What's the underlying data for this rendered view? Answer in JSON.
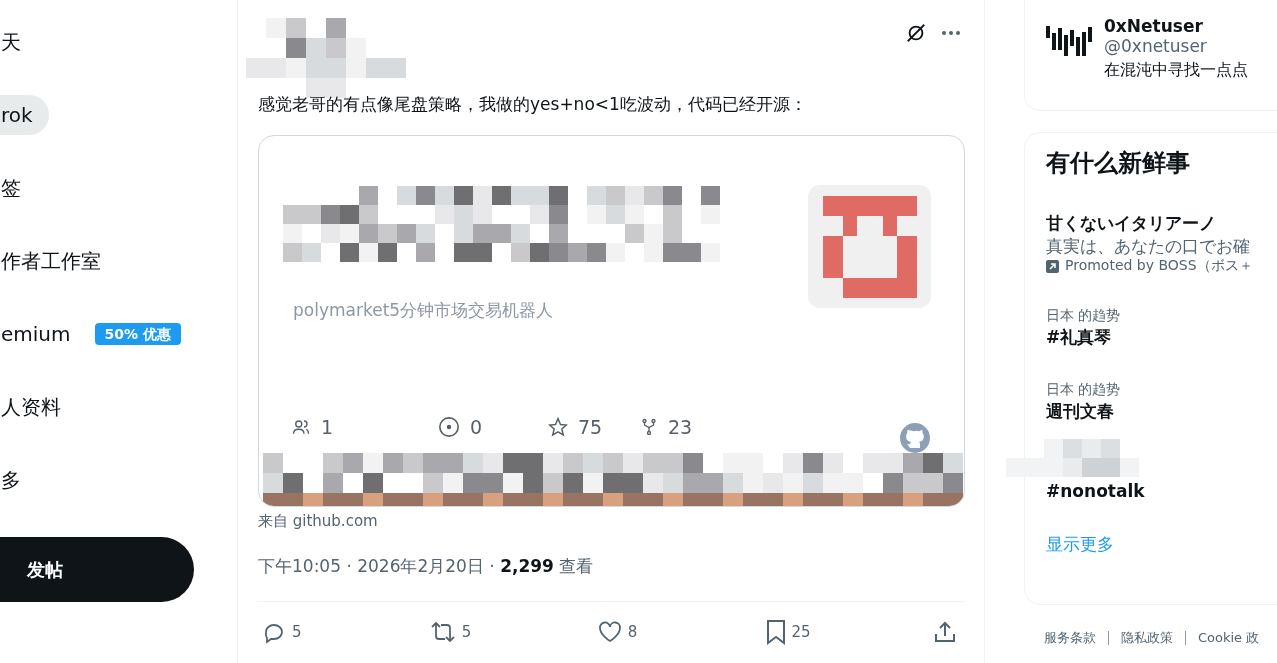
{
  "nav": {
    "items": [
      {
        "label": "天",
        "highlighted": false
      },
      {
        "label": "rok",
        "highlighted": true
      },
      {
        "label": "签",
        "highlighted": false
      },
      {
        "label": "作者工作室",
        "highlighted": false
      },
      {
        "label": "emium",
        "highlighted": false,
        "badge": "50% 优惠"
      },
      {
        "label": "人资料",
        "highlighted": false
      },
      {
        "label": "多",
        "highlighted": false
      }
    ],
    "post_button": "发帖"
  },
  "tweet": {
    "text": "感觉老哥的有点像尾盘策略，我做的yes+no<1吃波动，代码已经开源：",
    "card": {
      "description": "polymarket5分钟市场交易机器人",
      "stats": [
        {
          "kind": "contributors",
          "value": "1"
        },
        {
          "kind": "issues",
          "value": "0"
        },
        {
          "kind": "stars",
          "value": "75"
        },
        {
          "kind": "forks",
          "value": "23"
        }
      ],
      "source": "来自 github.com"
    },
    "time": "下午10:05 · 2026年2月20日 · ",
    "views": "2,299",
    "views_label": " 查看",
    "actions": [
      {
        "kind": "reply",
        "count": "5"
      },
      {
        "kind": "repost",
        "count": "5"
      },
      {
        "kind": "like",
        "count": "8"
      },
      {
        "kind": "bookmark",
        "count": "25"
      },
      {
        "kind": "share"
      }
    ]
  },
  "profile": {
    "name": "0xNetuser",
    "handle": "@0xnetuser",
    "bio": "在混沌中寻找一点点"
  },
  "trends": {
    "title": "有什么新鲜事",
    "items": [
      {
        "kind": "promoted",
        "title": "甘くないイタリアーノ",
        "text": "真実は、あなたの口でお確",
        "promoted": "Promoted by BOSS（ボス＋"
      },
      {
        "kind": "trend",
        "context": "日本 的趋势",
        "title": "#礼真琴"
      },
      {
        "kind": "trend",
        "context": "日本 的趋势",
        "title": "週刊文春"
      },
      {
        "kind": "trend",
        "title": "#nonotalk"
      }
    ],
    "show_more": "显示更多"
  },
  "footer": [
    "服务条款",
    "隐私政策",
    "Cookie 政"
  ]
}
